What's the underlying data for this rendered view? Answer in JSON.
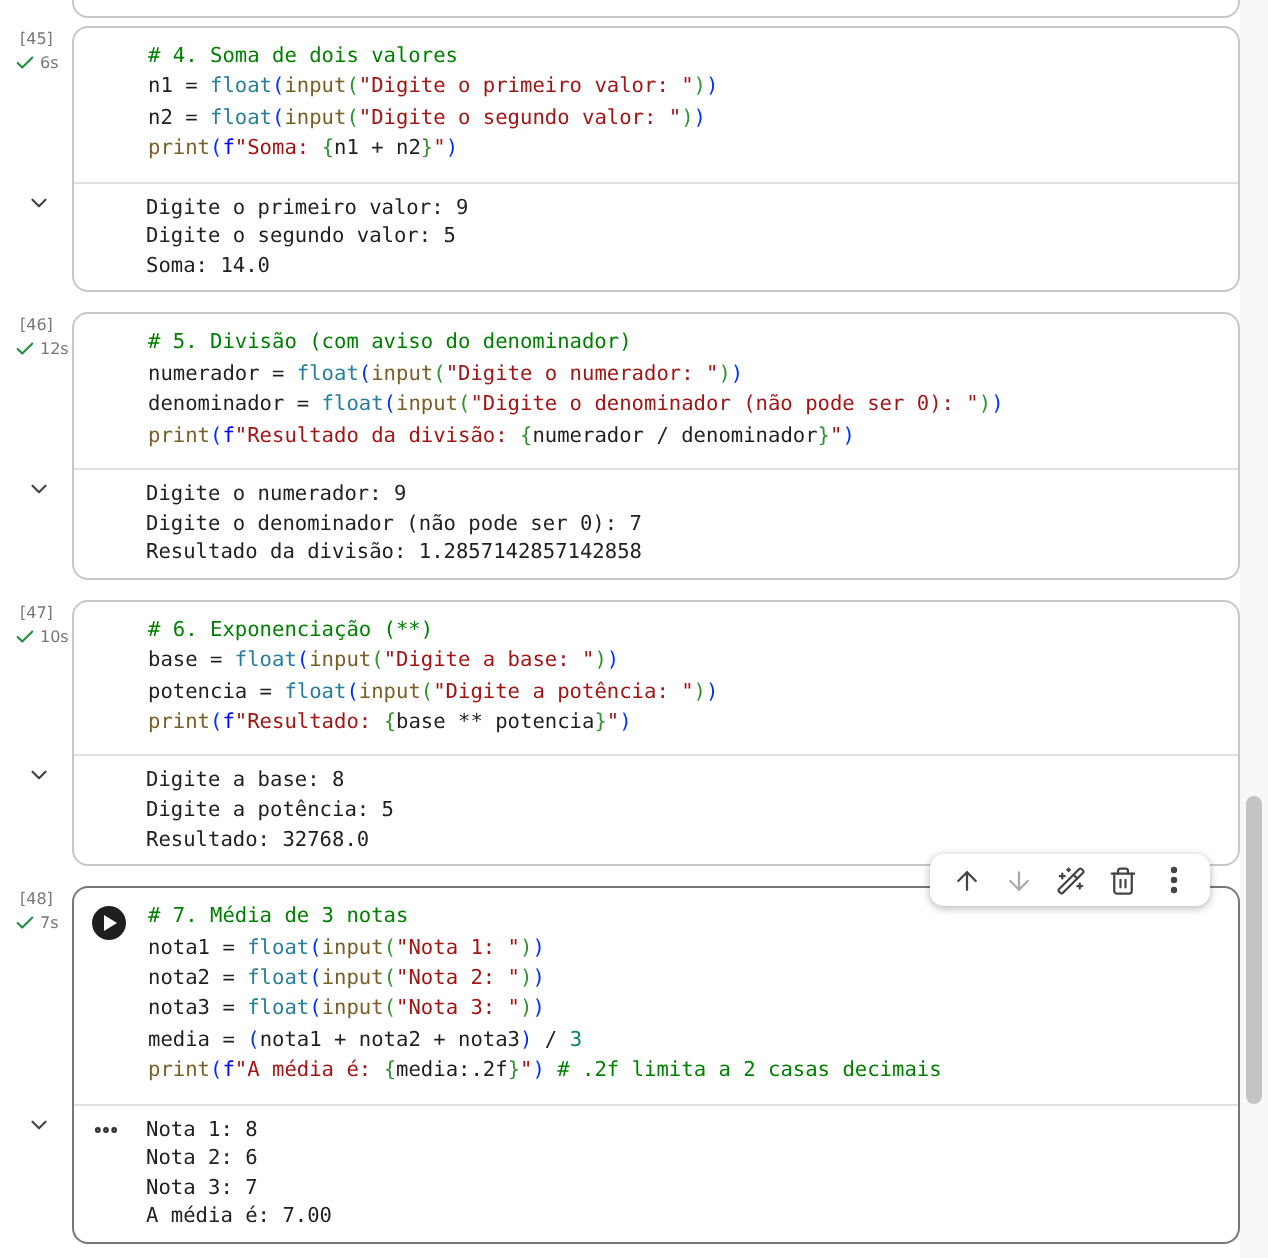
{
  "cells": [
    {
      "count": "[45]",
      "duration": "6s",
      "completed": true,
      "focused": false,
      "code": [
        [
          {
            "kind": "comment",
            "text": "# 4. Soma de dois valores"
          }
        ],
        [
          {
            "kind": "plain",
            "text": "n1 = "
          },
          {
            "kind": "type",
            "text": "float"
          },
          {
            "kind": "paren1",
            "text": "("
          },
          {
            "kind": "func",
            "text": "input"
          },
          {
            "kind": "paren2",
            "text": "("
          },
          {
            "kind": "string",
            "text": "\"Digite o primeiro valor: \""
          },
          {
            "kind": "paren2",
            "text": ")"
          },
          {
            "kind": "paren1",
            "text": ")"
          }
        ],
        [
          {
            "kind": "plain",
            "text": "n2 = "
          },
          {
            "kind": "type",
            "text": "float"
          },
          {
            "kind": "paren1",
            "text": "("
          },
          {
            "kind": "func",
            "text": "input"
          },
          {
            "kind": "paren2",
            "text": "("
          },
          {
            "kind": "string",
            "text": "\"Digite o segundo valor: \""
          },
          {
            "kind": "paren2",
            "text": ")"
          },
          {
            "kind": "paren1",
            "text": ")"
          }
        ],
        [
          {
            "kind": "func",
            "text": "print"
          },
          {
            "kind": "paren1",
            "text": "("
          },
          {
            "kind": "prefix",
            "text": "f"
          },
          {
            "kind": "string",
            "text": "\"Soma: "
          },
          {
            "kind": "paren2",
            "text": "{"
          },
          {
            "kind": "plain",
            "text": "n1 + n2"
          },
          {
            "kind": "paren2",
            "text": "}"
          },
          {
            "kind": "string",
            "text": "\""
          },
          {
            "kind": "paren1",
            "text": ")"
          }
        ]
      ],
      "output": [
        "Digite o primeiro valor: 9",
        "Digite o segundo valor: 5",
        "Soma: 14.0"
      ]
    },
    {
      "count": "[46]",
      "duration": "12s",
      "completed": true,
      "focused": false,
      "code": [
        [
          {
            "kind": "comment",
            "text": "# 5. Divisão (com aviso do denominador)"
          }
        ],
        [
          {
            "kind": "plain",
            "text": "numerador = "
          },
          {
            "kind": "type",
            "text": "float"
          },
          {
            "kind": "paren1",
            "text": "("
          },
          {
            "kind": "func",
            "text": "input"
          },
          {
            "kind": "paren2",
            "text": "("
          },
          {
            "kind": "string",
            "text": "\"Digite o numerador: \""
          },
          {
            "kind": "paren2",
            "text": ")"
          },
          {
            "kind": "paren1",
            "text": ")"
          }
        ],
        [
          {
            "kind": "plain",
            "text": "denominador = "
          },
          {
            "kind": "type",
            "text": "float"
          },
          {
            "kind": "paren1",
            "text": "("
          },
          {
            "kind": "func",
            "text": "input"
          },
          {
            "kind": "paren2",
            "text": "("
          },
          {
            "kind": "string",
            "text": "\"Digite o denominador (não pode ser 0): \""
          },
          {
            "kind": "paren2",
            "text": ")"
          },
          {
            "kind": "paren1",
            "text": ")"
          }
        ],
        [
          {
            "kind": "func",
            "text": "print"
          },
          {
            "kind": "paren1",
            "text": "("
          },
          {
            "kind": "prefix",
            "text": "f"
          },
          {
            "kind": "string",
            "text": "\"Resultado da divisão: "
          },
          {
            "kind": "paren2",
            "text": "{"
          },
          {
            "kind": "plain",
            "text": "numerador / denominador"
          },
          {
            "kind": "paren2",
            "text": "}"
          },
          {
            "kind": "string",
            "text": "\""
          },
          {
            "kind": "paren1",
            "text": ")"
          }
        ]
      ],
      "output": [
        "Digite o numerador: 9",
        "Digite o denominador (não pode ser 0): 7",
        "Resultado da divisão: 1.2857142857142858"
      ]
    },
    {
      "count": "[47]",
      "duration": "10s",
      "completed": true,
      "focused": false,
      "code": [
        [
          {
            "kind": "comment",
            "text": "# 6. Exponenciação (**)"
          }
        ],
        [
          {
            "kind": "plain",
            "text": "base = "
          },
          {
            "kind": "type",
            "text": "float"
          },
          {
            "kind": "paren1",
            "text": "("
          },
          {
            "kind": "func",
            "text": "input"
          },
          {
            "kind": "paren2",
            "text": "("
          },
          {
            "kind": "string",
            "text": "\"Digite a base: \""
          },
          {
            "kind": "paren2",
            "text": ")"
          },
          {
            "kind": "paren1",
            "text": ")"
          }
        ],
        [
          {
            "kind": "plain",
            "text": "potencia = "
          },
          {
            "kind": "type",
            "text": "float"
          },
          {
            "kind": "paren1",
            "text": "("
          },
          {
            "kind": "func",
            "text": "input"
          },
          {
            "kind": "paren2",
            "text": "("
          },
          {
            "kind": "string",
            "text": "\"Digite a potência: \""
          },
          {
            "kind": "paren2",
            "text": ")"
          },
          {
            "kind": "paren1",
            "text": ")"
          }
        ],
        [
          {
            "kind": "func",
            "text": "print"
          },
          {
            "kind": "paren1",
            "text": "("
          },
          {
            "kind": "prefix",
            "text": "f"
          },
          {
            "kind": "string",
            "text": "\"Resultado: "
          },
          {
            "kind": "paren2",
            "text": "{"
          },
          {
            "kind": "plain",
            "text": "base ** potencia"
          },
          {
            "kind": "paren2",
            "text": "}"
          },
          {
            "kind": "string",
            "text": "\""
          },
          {
            "kind": "paren1",
            "text": ")"
          }
        ]
      ],
      "output": [
        "Digite a base: 8",
        "Digite a potência: 5",
        "Resultado: 32768.0"
      ]
    },
    {
      "count": "[48]",
      "duration": "7s",
      "completed": true,
      "focused": true,
      "code": [
        [
          {
            "kind": "comment",
            "text": "# 7. Média de 3 notas"
          }
        ],
        [
          {
            "kind": "plain",
            "text": "nota1 = "
          },
          {
            "kind": "type",
            "text": "float"
          },
          {
            "kind": "paren1",
            "text": "("
          },
          {
            "kind": "func",
            "text": "input"
          },
          {
            "kind": "paren2",
            "text": "("
          },
          {
            "kind": "string",
            "text": "\"Nota 1: \""
          },
          {
            "kind": "paren2",
            "text": ")"
          },
          {
            "kind": "paren1",
            "text": ")"
          }
        ],
        [
          {
            "kind": "plain",
            "text": "nota2 = "
          },
          {
            "kind": "type",
            "text": "float"
          },
          {
            "kind": "paren1",
            "text": "("
          },
          {
            "kind": "func",
            "text": "input"
          },
          {
            "kind": "paren2",
            "text": "("
          },
          {
            "kind": "string",
            "text": "\"Nota 2: \""
          },
          {
            "kind": "paren2",
            "text": ")"
          },
          {
            "kind": "paren1",
            "text": ")"
          }
        ],
        [
          {
            "kind": "plain",
            "text": "nota3 = "
          },
          {
            "kind": "type",
            "text": "float"
          },
          {
            "kind": "paren1",
            "text": "("
          },
          {
            "kind": "func",
            "text": "input"
          },
          {
            "kind": "paren2",
            "text": "("
          },
          {
            "kind": "string",
            "text": "\"Nota 3: \""
          },
          {
            "kind": "paren2",
            "text": ")"
          },
          {
            "kind": "paren1",
            "text": ")"
          }
        ],
        [
          {
            "kind": "plain",
            "text": "media = "
          },
          {
            "kind": "paren1",
            "text": "("
          },
          {
            "kind": "plain",
            "text": "nota1 + nota2 + nota3"
          },
          {
            "kind": "paren1",
            "text": ")"
          },
          {
            "kind": "plain",
            "text": " / "
          },
          {
            "kind": "number",
            "text": "3"
          }
        ],
        [
          {
            "kind": "func",
            "text": "print"
          },
          {
            "kind": "paren1",
            "text": "("
          },
          {
            "kind": "prefix",
            "text": "f"
          },
          {
            "kind": "string",
            "text": "\"A média é: "
          },
          {
            "kind": "paren2",
            "text": "{"
          },
          {
            "kind": "plain",
            "text": "media:.2f"
          },
          {
            "kind": "paren2",
            "text": "}"
          },
          {
            "kind": "string",
            "text": "\""
          },
          {
            "kind": "paren1",
            "text": ")"
          },
          {
            "kind": "comment",
            "text": " # .2f limita a 2 casas decimais"
          }
        ]
      ],
      "output": [
        "Nota 1: 8",
        "Nota 2: 6",
        "Nota 3: 7",
        "A média é: 7.00"
      ]
    }
  ],
  "cell_toolbar": [
    {
      "kind": "up",
      "disabled": false
    },
    {
      "kind": "down",
      "disabled": true
    },
    {
      "kind": "edit",
      "disabled": false
    },
    {
      "kind": "delete",
      "disabled": false
    },
    {
      "kind": "more",
      "disabled": false
    }
  ]
}
